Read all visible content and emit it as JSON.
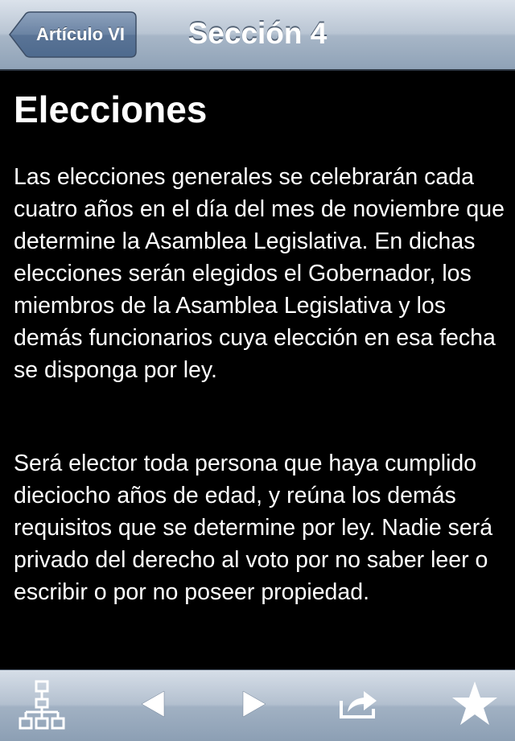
{
  "navbar": {
    "back_label": "Artículo VI",
    "title": "Sección 4"
  },
  "content": {
    "heading": "Elecciones",
    "paragraphs": [
      "Las elecciones generales se celebrarán cada cuatro años en el día del mes de noviembre que determine la Asamblea Legislativa. En dichas elecciones serán elegidos el Gobernador, los miembros de la Asamblea Legislativa y los demás funcionarios cuya elección en esa fecha se disponga por ley.",
      "Será elector toda persona que haya cumplido dieciocho años de edad, y reúna los demás requisitos que se determine por ley. Nadie será privado del derecho al voto por no saber leer o escribir o por no poseer propiedad."
    ]
  },
  "toolbar": {
    "icons": [
      "sitemap-icon",
      "previous-arrow-icon",
      "next-arrow-icon",
      "share-icon",
      "star-icon"
    ]
  },
  "colors": {
    "bar_gradient_top": "#dbe2eb",
    "bar_gradient_bottom": "#8fa2b7",
    "back_button": "#5e7594",
    "content_background": "#000000",
    "text": "#ffffff"
  }
}
